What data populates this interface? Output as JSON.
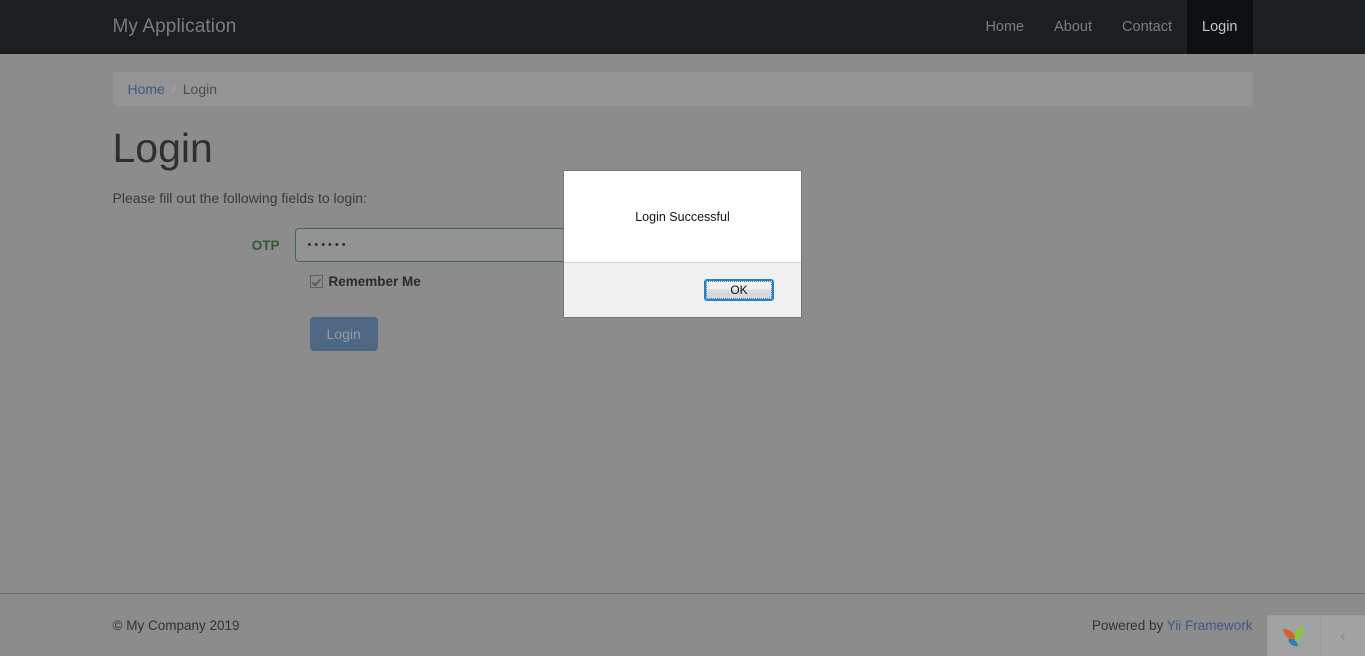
{
  "navbar": {
    "brand": "My Application",
    "links": [
      {
        "label": "Home",
        "active": false
      },
      {
        "label": "About",
        "active": false
      },
      {
        "label": "Contact",
        "active": false
      },
      {
        "label": "Login",
        "active": true
      }
    ]
  },
  "breadcrumb": {
    "home": "Home",
    "separator": "/",
    "current": "Login"
  },
  "main": {
    "title": "Login",
    "lead": "Please fill out the following fields to login:",
    "form": {
      "otp_label": "OTP",
      "otp_value": "••••••",
      "otp_placeholder": "",
      "remember_label": "Remember Me",
      "remember_checked": true,
      "submit_label": "Login"
    }
  },
  "dialog": {
    "message": "Login Successful",
    "ok_label": "OK"
  },
  "footer": {
    "copyright": "© My Company 2019",
    "powered_prefix": "Powered by",
    "powered_link": "Yii Framework",
    "toolbar_toggle": "‹"
  },
  "colors": {
    "navbar_bg": "#1c1e22",
    "navbar_active_bg": "#0f1012",
    "page_overlay": "#8c8c8c",
    "label_green": "#2e5b35",
    "link_blue": "#3c5a82",
    "button_blue": "#4e6884",
    "dialog_focus_blue": "#2a7fc1"
  }
}
